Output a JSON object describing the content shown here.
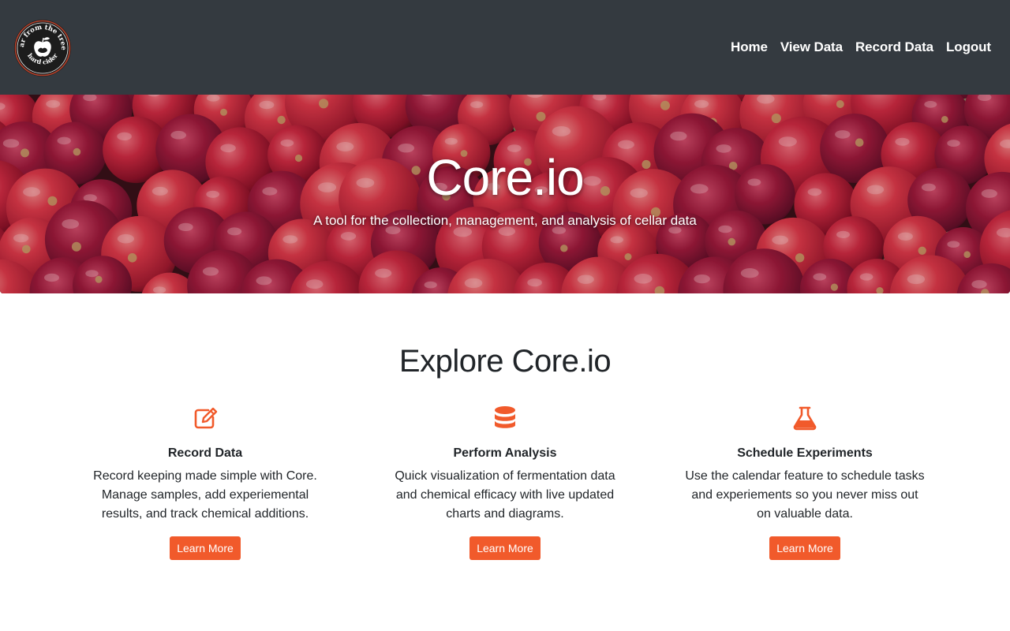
{
  "colors": {
    "navbar": "#343a40",
    "accent": "#f15a2b",
    "text": "#212529"
  },
  "brand": {
    "logo_icon": "far-from-the-tree-hard-cider-logo",
    "logo_text_top": "far from the tree",
    "logo_text_bottom": "hard cider"
  },
  "nav": {
    "items": [
      {
        "label": "Home"
      },
      {
        "label": "View Data"
      },
      {
        "label": "Record Data"
      },
      {
        "label": "Logout"
      }
    ]
  },
  "hero": {
    "title": "Core.io",
    "subtitle": "A tool for the collection, management, and analysis of cellar data",
    "background_icon": "red-apples-photo"
  },
  "explore": {
    "title": "Explore Core.io",
    "features": [
      {
        "icon": "edit-icon",
        "title": "Record Data",
        "text": "Record keeping made simple with Core. Manage samples, add experiemental results, and track chemical additions.",
        "button": "Learn More"
      },
      {
        "icon": "database-icon",
        "title": "Perform Analysis",
        "text": "Quick visualization of fermentation data and chemical efficacy with live updated charts and diagrams.",
        "button": "Learn More"
      },
      {
        "icon": "flask-icon",
        "title": "Schedule Experiments",
        "text": "Use the calendar feature to schedule tasks and experiements so you never miss out on valuable data.",
        "button": "Learn More"
      }
    ]
  }
}
